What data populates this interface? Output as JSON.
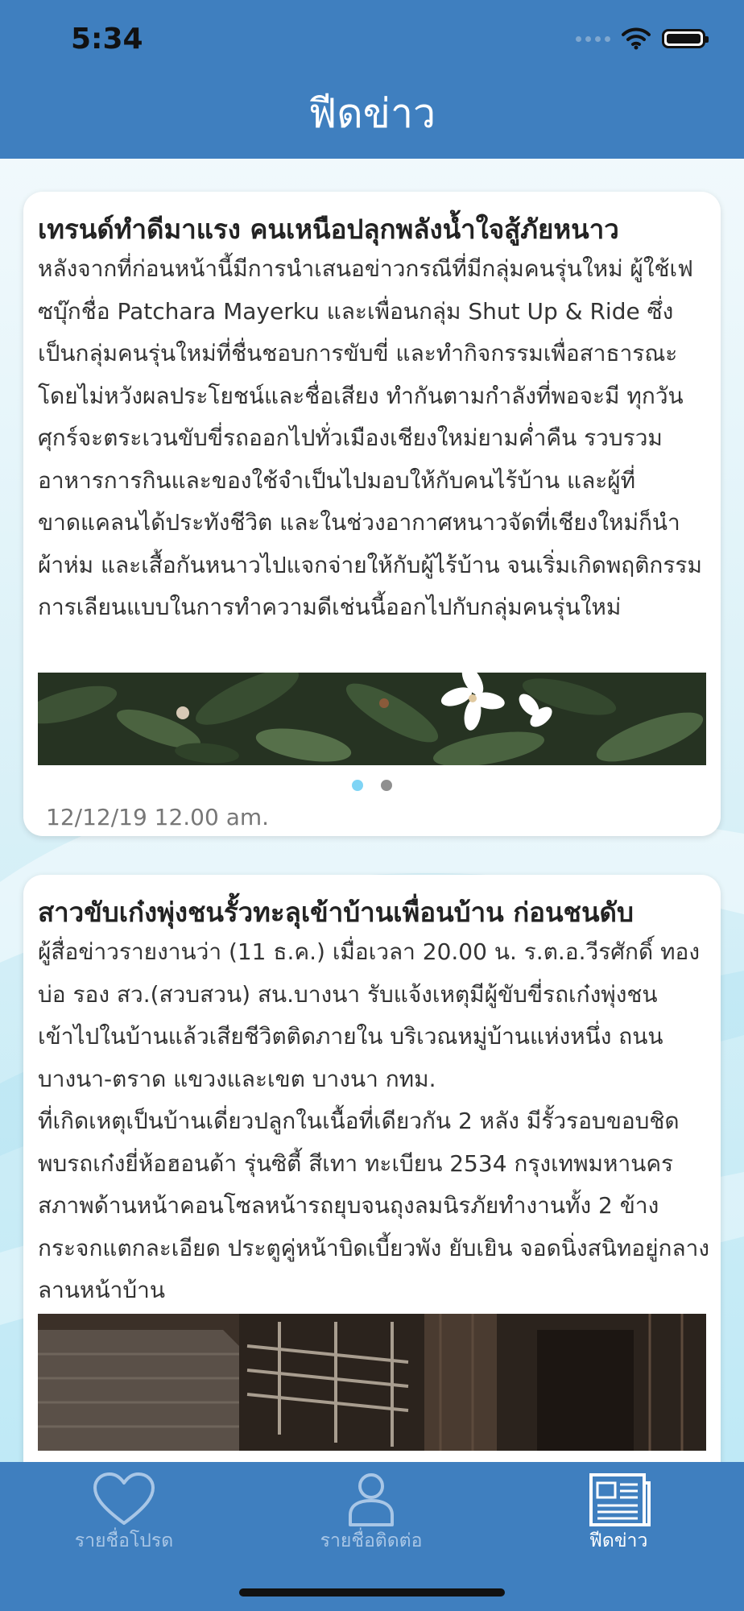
{
  "status": {
    "time": "5:34"
  },
  "header": {
    "title": "ฟีดข่าว"
  },
  "cards": [
    {
      "title": "เทรนด์ทำดีมาแรง คนเหนือปลุกพลังน้ำใจสู้ภัยหนาว",
      "body": "หลังจากที่ก่อนหน้านี้มีการนำเสนอข่าวกรณีที่มีกลุ่มคนรุ่นใหม่ ผู้ใช้เฟซบุ๊กชื่อ Patchara Mayerku และเพื่อนกลุ่ม Shut Up & Ride ซึ่งเป็นกลุ่มคนรุ่นใหม่ที่ชื่นชอบการขับขี่ และทำกิจกรรมเพื่อสาธารณะโดยไม่หวังผลประโยชน์และชื่อเสียง ทำกันตามกำลังที่พอจะมี ทุกวันศุกร์จะตระเวนขับขี่รถออกไปทั่วเมืองเชียงใหม่ยามค่ำคืน รวบรวมอาหารการกินและของใช้จำเป็นไปมอบให้กับคนไร้บ้าน และผู้ที่ขาดแคลนได้ประทังชีวิต และในช่วงอากาศหนาวจัดที่เชียงใหม่ก็นำผ้าห่ม และเสื้อกันหนาวไปแจกจ่ายให้กับผู้ไร้บ้าน จนเริ่มเกิดพฤติกรรมการเลียนแบบในการทำความดีเช่นนี้ออกไปกับกลุ่มคนรุ่นใหม่",
      "date": "12/12/19 12.00 am.",
      "image_count": 2,
      "active_image": 0
    },
    {
      "title": "สาวขับเก๋งพุ่งชนรั้วทะลุเข้าบ้านเพื่อนบ้าน ก่อนชนดับ",
      "body": "ผู้สื่อข่าวรายงานว่า (11 ธ.ค.) เมื่อเวลา 20.00 น. ร.ต.อ.วีรศักดิ์ ทองบ่อ รอง สว.(สวบสวน) สน.บางนา รับแจ้งเหตุมีผู้ขับขี่รถเก๋งพุ่งชนเข้าไปในบ้านแล้วเสียชีวิตติดภายใน บริเวณหมู่บ้านแห่งหนึ่ง ถนนบางนา-ตราด แขวงและเขต บางนา กทม.\nที่เกิดเหตุเป็นบ้านเดี่ยวปลูกในเนื้อที่เดียวกัน 2 หลัง มีรั้วรอบขอบชิด พบรถเก๋งยี่ห้อฮอนด้า รุ่นซิตี้ สีเทา ทะเบียน 2534 กรุงเทพมหานคร สภาพด้านหน้าคอนโซลหน้ารถยุบจนถุงลมนิรภัยทำงานทั้ง 2 ข้าง กระจกแตกละเอียด ประตูคู่หน้าบิดเบี้ยวพัง ยับเยิน จอดนิ่งสนิทอยู่กลางลานหน้าบ้าน"
    }
  ],
  "tabbar": {
    "items": [
      {
        "label": "รายชื่อโปรด",
        "icon": "heart-icon"
      },
      {
        "label": "รายชื่อติดต่อ",
        "icon": "person-icon"
      },
      {
        "label": "ฟีดข่าว",
        "icon": "newspaper-icon",
        "active": true
      }
    ]
  },
  "colors": {
    "primary": "#3f7fbf",
    "active_dot": "#7fd4f5",
    "inactive_tab": "#a8c6e6"
  }
}
